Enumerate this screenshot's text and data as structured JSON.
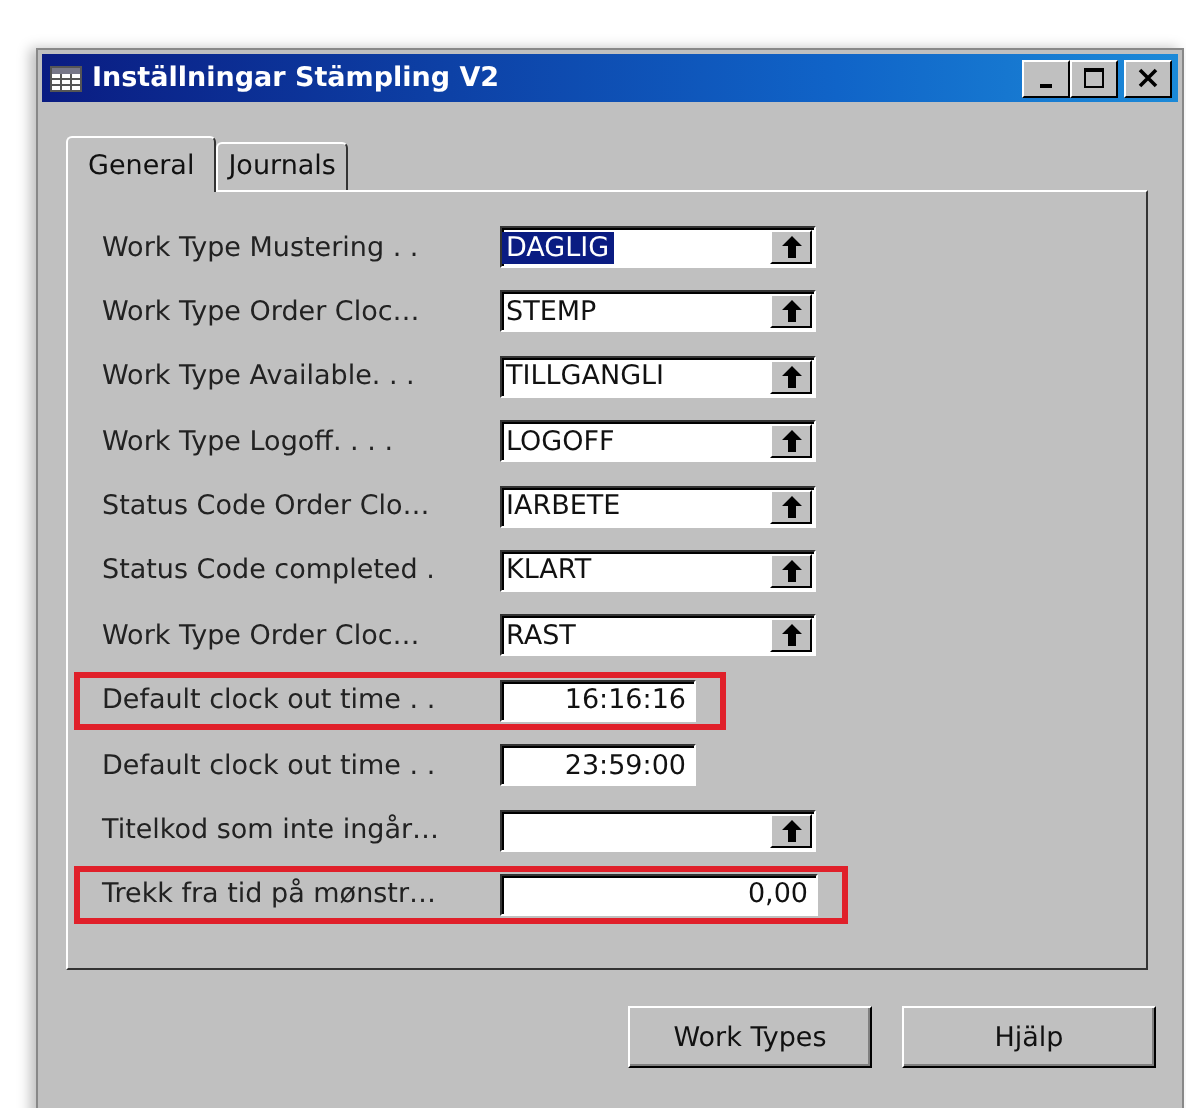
{
  "window": {
    "title": "Inställningar Stämpling V2"
  },
  "tabs": [
    {
      "label": "General",
      "selected": true
    },
    {
      "label": "Journals",
      "selected": false
    }
  ],
  "fields": [
    {
      "label": "Work Type Mustering . .",
      "kind": "lookup",
      "value": "DAGLIG",
      "text_selected": true,
      "highlighted": false
    },
    {
      "label": "Work Type Order Cloc…",
      "kind": "lookup",
      "value": "STEMP",
      "text_selected": false,
      "highlighted": false
    },
    {
      "label": "Work Type Available. . .",
      "kind": "lookup",
      "value": "TILLGANGLI",
      "text_selected": false,
      "highlighted": false
    },
    {
      "label": "Work Type Logoff. . . .",
      "kind": "lookup",
      "value": "LOGOFF",
      "text_selected": false,
      "highlighted": false
    },
    {
      "label": "Status Code Order Clo…",
      "kind": "lookup",
      "value": "IARBETE",
      "text_selected": false,
      "highlighted": false
    },
    {
      "label": "Status Code completed .",
      "kind": "lookup",
      "value": "KLART",
      "text_selected": false,
      "highlighted": false
    },
    {
      "label": "Work Type Order Cloc…",
      "kind": "lookup",
      "value": "RAST",
      "text_selected": false,
      "highlighted": false
    },
    {
      "label": "Default clock out time . .",
      "kind": "time",
      "value": "16:16:16",
      "text_selected": false,
      "highlighted": true
    },
    {
      "label": "Default clock out time . .",
      "kind": "time",
      "value": "23:59:00",
      "text_selected": false,
      "highlighted": false
    },
    {
      "label": "Titelkod som inte ingår…",
      "kind": "lookup",
      "highlighted": false
    },
    {
      "label": "Trekk fra tid på mønstr…",
      "kind": "decimal",
      "value": "0,00",
      "text_selected": false,
      "highlighted": true
    }
  ],
  "buttons": [
    "Work Types",
    "Hjälp"
  ]
}
